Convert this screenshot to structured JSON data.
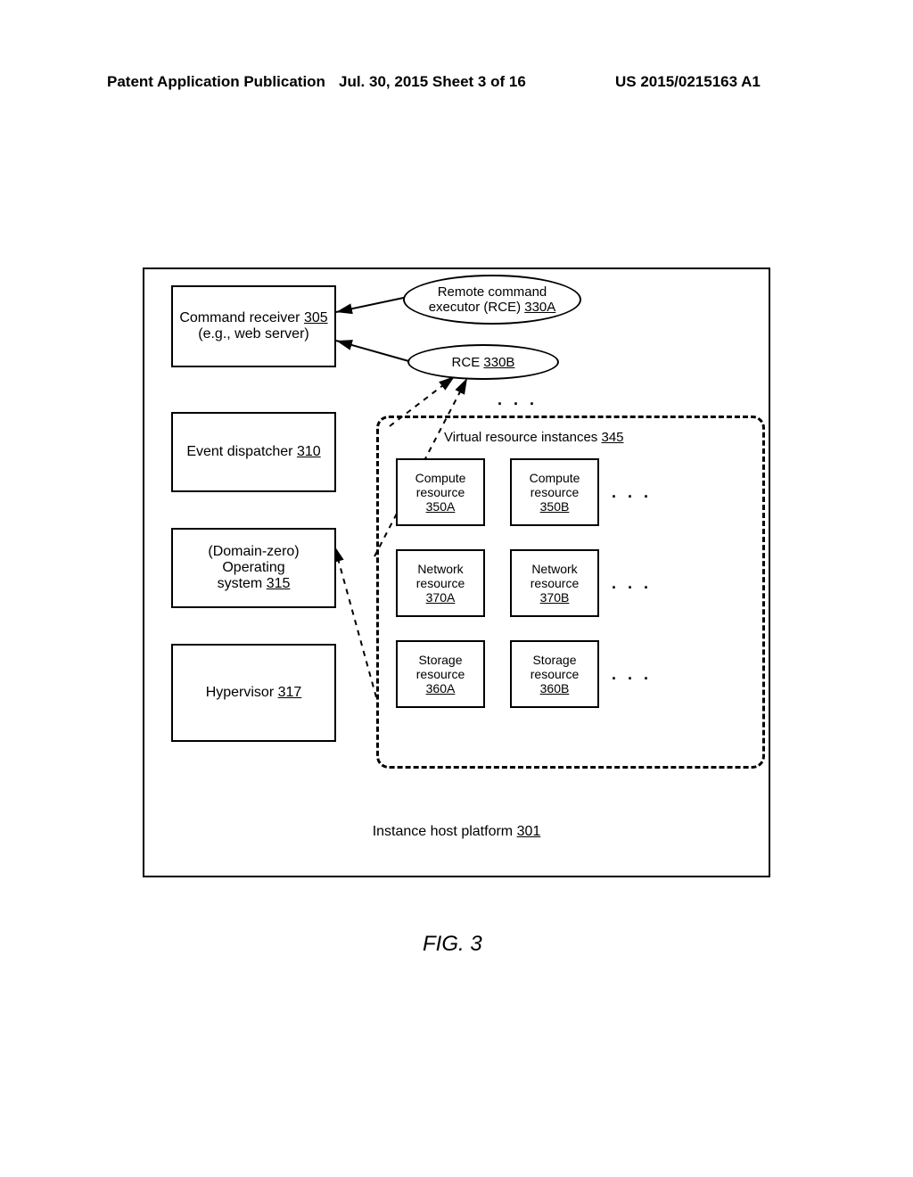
{
  "header": {
    "left": "Patent Application Publication",
    "mid": "Jul. 30, 2015   Sheet 3 of 16",
    "right": "US 2015/0215163 A1"
  },
  "figure": {
    "caption": "FIG. 3",
    "platform_label": "Instance host platform",
    "platform_ref": "301",
    "command_receiver": {
      "line1": "Command receiver",
      "ref": "305",
      "line2": "(e.g., web server)"
    },
    "event_dispatcher": {
      "label": "Event dispatcher",
      "ref": "310"
    },
    "os": {
      "line1": "(Domain-zero) Operating",
      "line2": "system",
      "ref": "315"
    },
    "hypervisor": {
      "label": "Hypervisor",
      "ref": "317"
    },
    "rce_a": {
      "line1": "Remote command",
      "line2": "executor (RCE)",
      "ref": "330A"
    },
    "rce_b": {
      "label": "RCE",
      "ref": "330B"
    },
    "vri": {
      "label": "Virtual resource instances",
      "ref": "345"
    },
    "compute_a": {
      "l1": "Compute",
      "l2": "resource",
      "ref": "350A"
    },
    "compute_b": {
      "l1": "Compute",
      "l2": "resource",
      "ref": "350B"
    },
    "network_a": {
      "l1": "Network",
      "l2": "resource",
      "ref": "370A"
    },
    "network_b": {
      "l1": "Network",
      "l2": "resource",
      "ref": "370B"
    },
    "storage_a": {
      "l1": "Storage",
      "l2": "resource",
      "ref": "360A"
    },
    "storage_b": {
      "l1": "Storage",
      "l2": "resource",
      "ref": "360B"
    }
  }
}
